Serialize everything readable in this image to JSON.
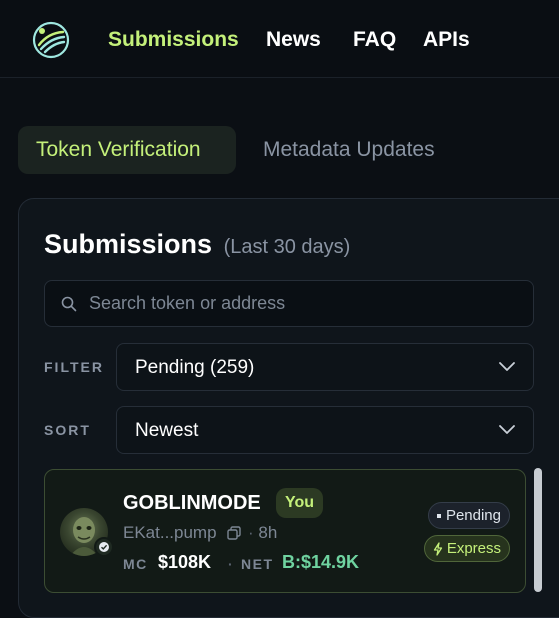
{
  "nav": {
    "links": [
      "Submissions",
      "News",
      "FAQ",
      "APIs"
    ],
    "accent": "#c4f07a"
  },
  "tabs": {
    "active": "Token Verification",
    "inactive": "Metadata Updates"
  },
  "panel": {
    "title": "Submissions",
    "subtitle": "(Last 30 days)",
    "search": {
      "placeholder": "Search token or address",
      "value": ""
    },
    "filter": {
      "label": "FILTER",
      "value": "Pending (259)"
    },
    "sort": {
      "label": "SORT",
      "value": "Newest"
    }
  },
  "card": {
    "name": "GOBLINMODE",
    "you_badge": "You",
    "address": "EKat...pump",
    "age_separator": "·",
    "age": "8h",
    "mc_label": "MC",
    "mc_value": "$108K",
    "net_label": "NET",
    "net_value": "B:$14.9K",
    "status": "Pending",
    "tier": "Express",
    "colors": {
      "net_value": "#6fd3a0",
      "mc_value": "#ffffff"
    }
  },
  "icons": [
    "logo-icon",
    "search-icon",
    "chevron-down-icon",
    "copy-icon",
    "verified-icon",
    "bolt-icon"
  ]
}
